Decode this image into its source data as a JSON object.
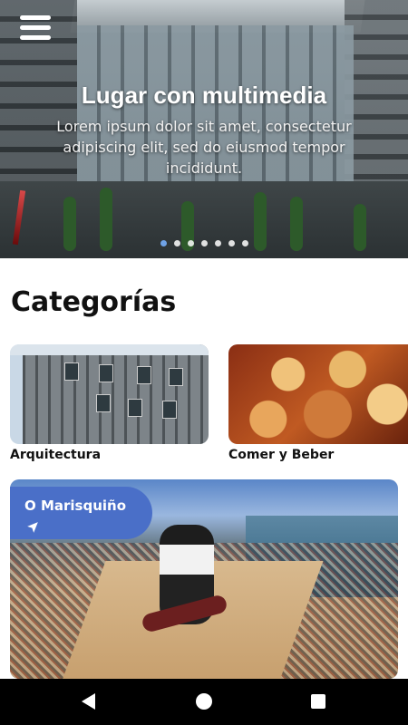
{
  "hero": {
    "title": "Lugar con multimedia",
    "description": "Lorem ipsum dolor sit amet, consectetur adipiscing elit, sed do eiusmod tempor incididunt.",
    "slide_count": 7,
    "active_slide": 1
  },
  "menu": {
    "icon": "hamburger-menu-icon"
  },
  "categories": {
    "title": "Categorías",
    "items": [
      {
        "label": "Arquitectura"
      },
      {
        "label": "Comer y Beber"
      }
    ]
  },
  "featured": {
    "title": "O Marisquiño",
    "icon": "navigation-arrow-icon",
    "badge_color": "#4a6fc8"
  },
  "system_nav": {
    "back_icon": "back-triangle-icon",
    "home_icon": "home-circle-icon",
    "recent_icon": "recent-apps-square-icon"
  },
  "colors": {
    "accent": "#4a6fc8",
    "active_dot": "#6fa2e6",
    "nav_bar": "#000000"
  }
}
